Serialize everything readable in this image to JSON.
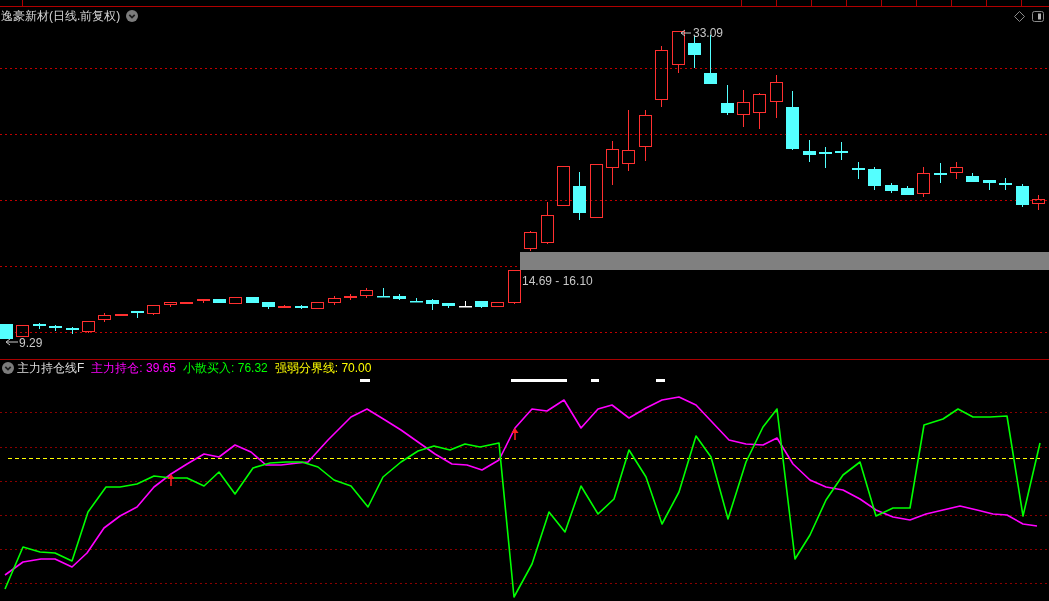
{
  "chart": {
    "title": "逸豪新材(日线.前复权)",
    "high_label": "33.09",
    "range_label": "14.69 - 16.10",
    "low_label": "9.29"
  },
  "indicator": {
    "name": "主力持仓线F",
    "readings": [
      {
        "label": "主力持仓: 39.65",
        "color": "#ff00ff"
      },
      {
        "label": "小散买入: 76.32",
        "color": "#00ff00"
      },
      {
        "label": "强弱分界线: 70.00",
        "color": "#ffff00"
      }
    ]
  }
}
